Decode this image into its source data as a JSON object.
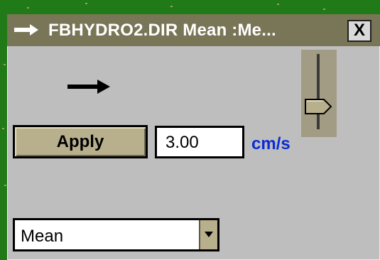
{
  "window": {
    "title": "FBHYDRO2.DIR Mean :Me...",
    "close_label": "X"
  },
  "controls": {
    "apply_label": "Apply",
    "value": "3.00",
    "unit": "cm/s",
    "mode_selected": "Mean"
  },
  "icons": {
    "title": "arrow-right-icon",
    "direction": "direction-arrow-icon",
    "dropdown": "chevron-down-icon"
  },
  "colors": {
    "titlebar": "#797557",
    "panel": "#bebebe",
    "accent_unit": "#0b2bd4",
    "button": "#b8b08d",
    "background": "#1f7a17"
  }
}
